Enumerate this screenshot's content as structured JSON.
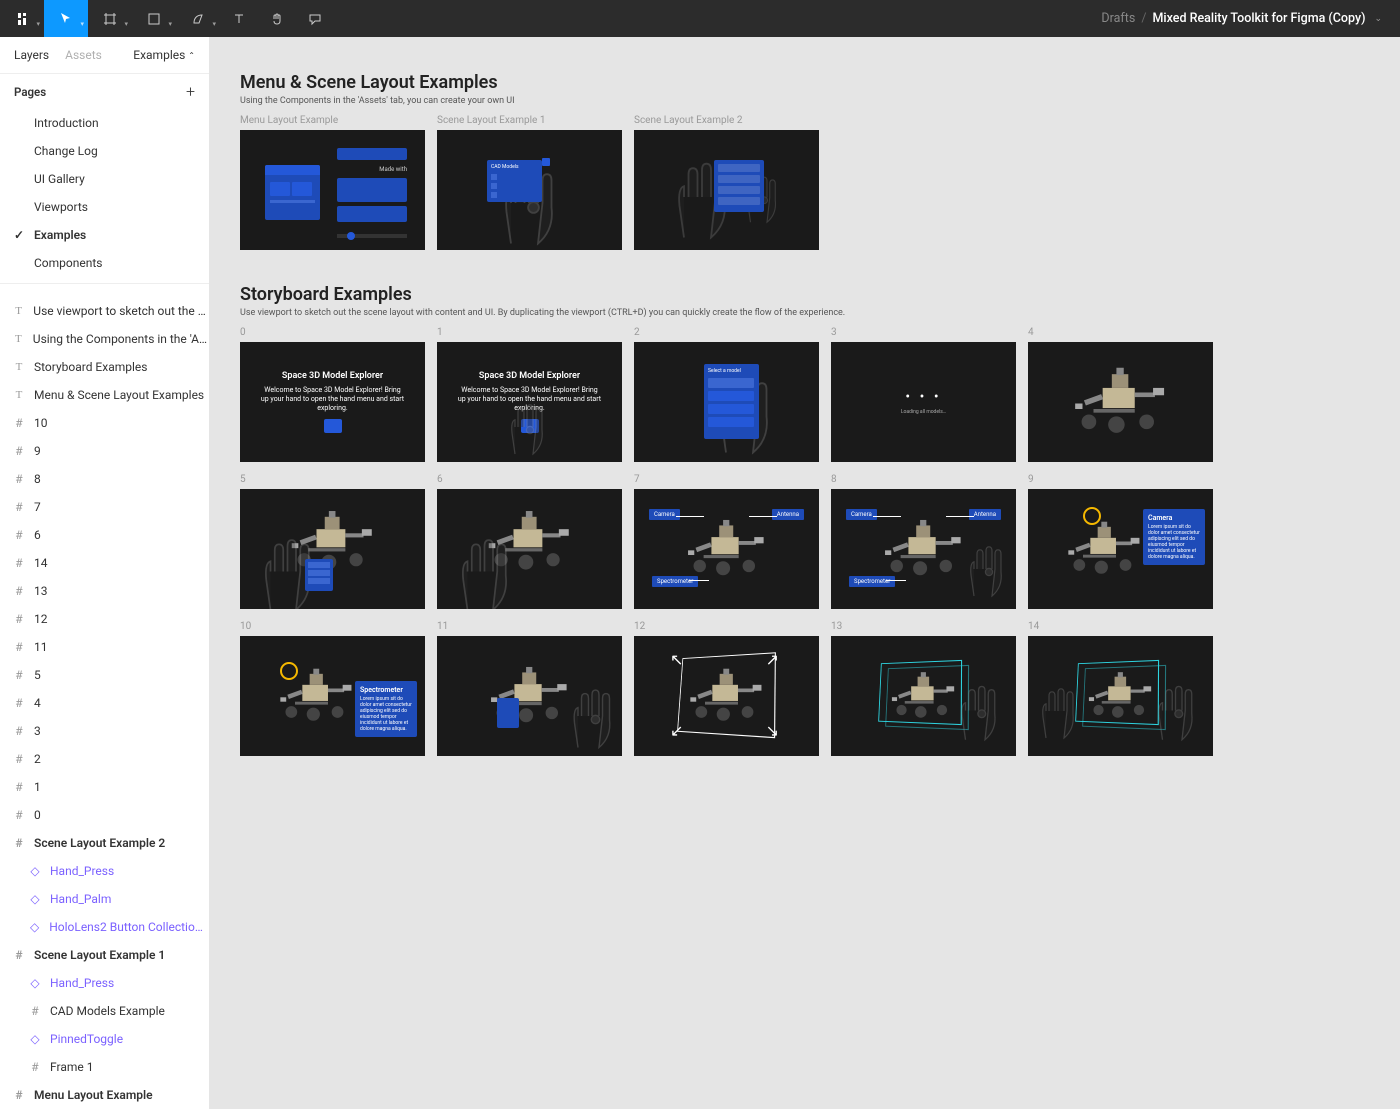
{
  "toolbar": {
    "breadcrumb_drafts": "Drafts",
    "breadcrumb_slash": "/",
    "breadcrumb_title": "Mixed Reality Toolkit for Figma (Copy)"
  },
  "sidebar": {
    "tabs": {
      "layers": "Layers",
      "assets": "Assets",
      "pages_dropdown": "Examples"
    },
    "pages_header": "Pages",
    "pages": [
      {
        "label": "Introduction"
      },
      {
        "label": "Change Log"
      },
      {
        "label": "UI Gallery"
      },
      {
        "label": "Viewports"
      },
      {
        "label": "Examples",
        "selected": true
      },
      {
        "label": "Components"
      }
    ],
    "layers": [
      {
        "icon": "T",
        "label": "Use viewport to sketch out the sc…"
      },
      {
        "icon": "T",
        "label": "Using the Components in the 'Asse…"
      },
      {
        "icon": "T",
        "label": "Storyboard Examples"
      },
      {
        "icon": "T",
        "label": "Menu & Scene Layout Examples"
      },
      {
        "icon": "#",
        "label": "10"
      },
      {
        "icon": "#",
        "label": "9"
      },
      {
        "icon": "#",
        "label": "8"
      },
      {
        "icon": "#",
        "label": "7"
      },
      {
        "icon": "#",
        "label": "6"
      },
      {
        "icon": "#",
        "label": "14"
      },
      {
        "icon": "#",
        "label": "13"
      },
      {
        "icon": "#",
        "label": "12"
      },
      {
        "icon": "#",
        "label": "11"
      },
      {
        "icon": "#",
        "label": "5"
      },
      {
        "icon": "#",
        "label": "4"
      },
      {
        "icon": "#",
        "label": "3"
      },
      {
        "icon": "#",
        "label": "2"
      },
      {
        "icon": "#",
        "label": "1"
      },
      {
        "icon": "#",
        "label": "0"
      },
      {
        "icon": "#",
        "label": "Scene Layout Example 2",
        "bold": true
      },
      {
        "icon": "◇",
        "label": "Hand_Press",
        "indent": 1,
        "purple": true
      },
      {
        "icon": "◇",
        "label": "Hand_Palm",
        "indent": 1,
        "purple": true
      },
      {
        "icon": "◇",
        "label": "HoloLens2 Button Collection 3V",
        "indent": 1,
        "purple": true
      },
      {
        "icon": "#",
        "label": "Scene Layout Example 1",
        "bold": true
      },
      {
        "icon": "◇",
        "label": "Hand_Press",
        "indent": 1,
        "purple": true
      },
      {
        "icon": "#",
        "label": "CAD Models Example",
        "indent": 1
      },
      {
        "icon": "◇",
        "label": "PinnedToggle",
        "indent": 1,
        "purple": true
      },
      {
        "icon": "#",
        "label": "Frame 1",
        "indent": 1
      },
      {
        "icon": "#",
        "label": "Menu Layout Example",
        "bold": true
      }
    ]
  },
  "canvas": {
    "section1": {
      "title": "Menu & Scene Layout Examples",
      "subtitle": "Using the Components in the 'Assets' tab, you can create your own UI",
      "frames": [
        {
          "label": "Menu Layout Example",
          "type": "menu"
        },
        {
          "label": "Scene Layout Example 1",
          "type": "scene1"
        },
        {
          "label": "Scene Layout Example 2",
          "type": "scene2"
        }
      ]
    },
    "section2": {
      "title": "Storyboard Examples",
      "subtitle": "Use viewport to sketch out the scene layout with content and UI. By duplicating the viewport (CTRL+D) you can quickly create the flow of the experience.",
      "frames": [
        {
          "label": "0",
          "type": "sb0",
          "title": "Space 3D Model Explorer",
          "desc": "Welcome to Space 3D Model Explorer! Bring up your hand to open the hand menu and start exploring."
        },
        {
          "label": "1",
          "type": "sb1",
          "title": "Space 3D Model Explorer",
          "desc": "Welcome to Space 3D Model Explorer! Bring up your hand to open the hand menu and start exploring."
        },
        {
          "label": "2",
          "type": "sb2",
          "menu_title": "Select a model"
        },
        {
          "label": "3",
          "type": "sb3",
          "loading": "Loading all models…"
        },
        {
          "label": "4",
          "type": "rover"
        },
        {
          "label": "5",
          "type": "sb5"
        },
        {
          "label": "6",
          "type": "sb6"
        },
        {
          "label": "7",
          "type": "sb7",
          "l1": "Camera",
          "l2": "Antenna",
          "l3": "Spectrometer"
        },
        {
          "label": "8",
          "type": "sb8",
          "l1": "Camera",
          "l2": "Antenna",
          "l3": "Spectrometer"
        },
        {
          "label": "9",
          "type": "sb9",
          "panel_hdr": "Camera",
          "panel_body": "Lorem ipsum sit do dolor amet consectetur adipiscing elit sed do eiusmod tempor incididunt ut labore et dolore magna aliqua."
        },
        {
          "label": "10",
          "type": "sb10",
          "panel_hdr": "Spectrometer",
          "panel_body": "Lorem ipsum sit do dolor amet consectetur adipiscing elit sed do eiusmod tempor incididunt ut labore et dolore magna aliqua."
        },
        {
          "label": "11",
          "type": "sb11"
        },
        {
          "label": "12",
          "type": "sb12"
        },
        {
          "label": "13",
          "type": "sb13"
        },
        {
          "label": "14",
          "type": "sb14"
        }
      ]
    }
  }
}
